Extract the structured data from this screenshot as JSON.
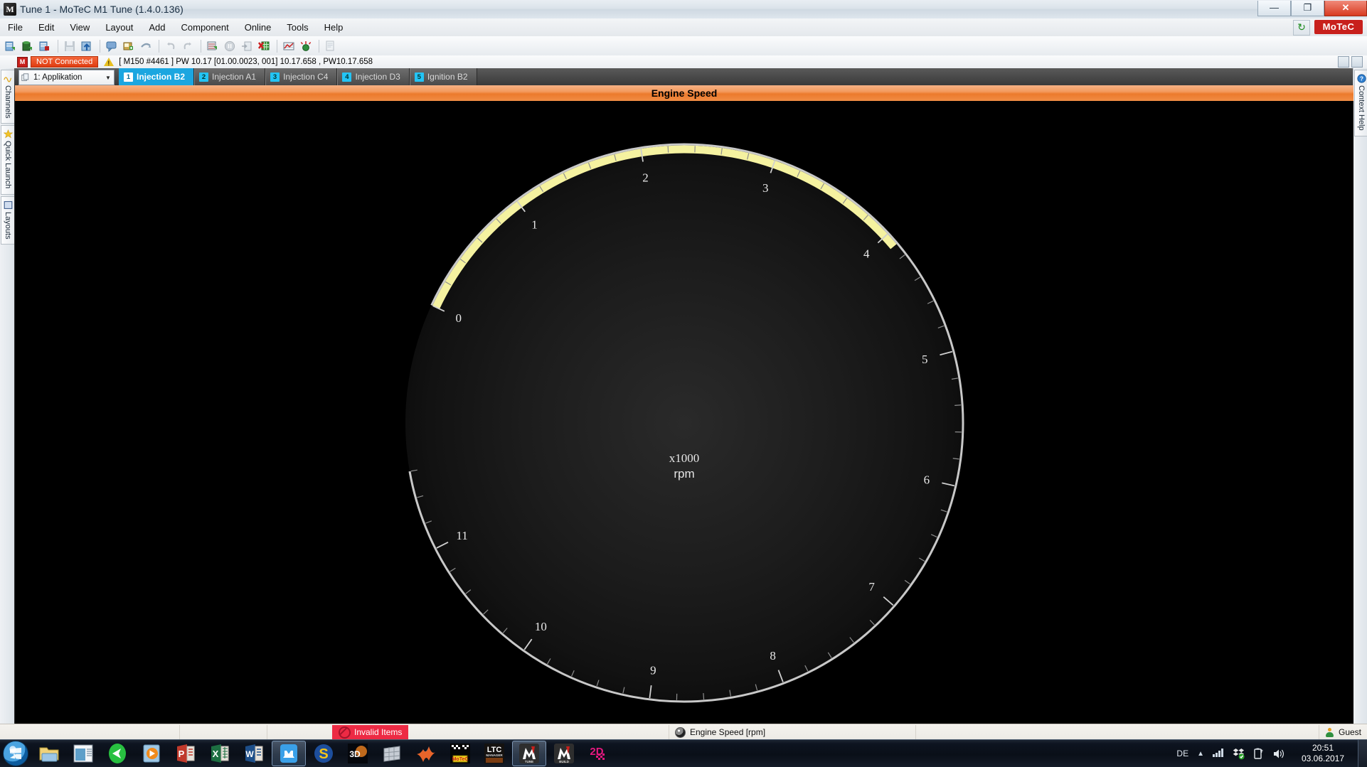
{
  "window": {
    "title": "Tune 1 - MoTeC M1 Tune (1.4.0.136)",
    "icon": "motec-m1-icon",
    "minimize": "—",
    "maximize": "❐",
    "close": "✕"
  },
  "menu": {
    "items": [
      {
        "label": "File"
      },
      {
        "label": "Edit"
      },
      {
        "label": "View"
      },
      {
        "label": "Layout"
      },
      {
        "label": "Add"
      },
      {
        "label": "Component"
      },
      {
        "label": "Online"
      },
      {
        "label": "Tools"
      },
      {
        "label": "Help"
      }
    ],
    "brand": "MoTeC",
    "refresh_icon": "↻"
  },
  "toolbar": {
    "buttons": [
      {
        "name": "new-tune",
        "color": "#6aa3d8"
      },
      {
        "name": "open-package",
        "color": "#2f6f2f"
      },
      {
        "name": "save-tune",
        "color": "#b33a3a"
      },
      {
        "name": "save",
        "color": "#7f8fa0"
      },
      {
        "name": "upload",
        "color": "#3f7fbf"
      },
      {
        "name": "comment",
        "color": "#5d8fc4"
      },
      {
        "name": "add-item",
        "color": "#3f9f3f"
      },
      {
        "name": "refresh-arrow",
        "color": "#8fa6bb"
      },
      {
        "name": "undo",
        "color": "#b8c2cc"
      },
      {
        "name": "redo",
        "color": "#b8c2cc"
      },
      {
        "name": "export-log",
        "color": "#3f9f3f"
      },
      {
        "name": "pause",
        "color": "#9aa6b2"
      },
      {
        "name": "import",
        "color": "#8b98a6"
      },
      {
        "name": "clear-grid",
        "color": "#cc2a2a"
      },
      {
        "name": "chart",
        "color": "#c03030"
      },
      {
        "name": "diagnostics",
        "color": "#2f8f3f"
      },
      {
        "name": "report",
        "color": "#9aa6b2"
      }
    ]
  },
  "connection_strip": {
    "device_badge": "M",
    "status": "NOT Connected",
    "warning_icon": "warning-triangle-icon",
    "info": "[ M150 #4461 ]  PW 10.17 [01.00.0023, 001] 10.17.658 , PW10.17.658"
  },
  "left_sidebar": {
    "tabs": [
      {
        "label": "Channels",
        "icon": "waveform-icon"
      },
      {
        "label": "Quick Launch",
        "icon": "star-icon"
      },
      {
        "label": "Layouts",
        "icon": "window-icon"
      }
    ]
  },
  "right_sidebar": {
    "tabs": [
      {
        "label": "Context Help",
        "icon": "help-question-icon"
      }
    ]
  },
  "workspace": {
    "selector": {
      "value": "1: Applikation",
      "icon": "pages-icon",
      "arrow": "▼"
    },
    "tabs": [
      {
        "num": "1",
        "label": "Injection B2",
        "active": true
      },
      {
        "num": "2",
        "label": "Injection A1",
        "active": false
      },
      {
        "num": "3",
        "label": "Injection C4",
        "active": false
      },
      {
        "num": "4",
        "label": "Injection D3",
        "active": false
      },
      {
        "num": "5",
        "label": "Ignition B2",
        "active": false
      }
    ]
  },
  "gauge": {
    "title": "Engine Speed",
    "center_line1": "x1000",
    "center_line2": "rpm",
    "accent": "#ec7a2c",
    "band_color": "#f5f2a0",
    "scale_color": "#c8c8c8",
    "label_color": "#e8e8e8"
  },
  "chart_data": {
    "type": "gauge",
    "title": "Engine Speed",
    "unit": "rpm",
    "unit_multiplier": "x1000",
    "min": 0,
    "max": 11.6,
    "major_ticks": [
      0,
      1,
      2,
      3,
      4,
      5,
      6,
      7,
      8,
      9,
      10,
      11
    ],
    "tick_labels": [
      "0",
      "1",
      "2",
      "3",
      "4",
      "5",
      "6",
      "6",
      "7",
      "8",
      "9",
      "10",
      "11"
    ],
    "minor_ticks_per_major": 5,
    "start_angle_deg": 205,
    "sweep_deg": 325,
    "value_band": {
      "from": 0,
      "to": 4.1,
      "color": "#f5f2a0"
    },
    "needle_value": null,
    "grid": false,
    "legend": "none"
  },
  "status_bar": {
    "invalid_items": "Invalid Items",
    "invalid_icon": "no-entry-icon",
    "channel": "Engine Speed [rpm]",
    "channel_icon": "gauge-icon",
    "user": "Guest",
    "user_icon": "user-icon"
  },
  "taskbar": {
    "start_icon": "windows-start-icon",
    "items": [
      {
        "name": "file-explorer",
        "label": "",
        "icon": "folder-icon"
      },
      {
        "name": "window-app",
        "label": "",
        "icon": "window-icon"
      },
      {
        "name": "media-player-green",
        "label": "",
        "icon": "play-triangle-icon"
      },
      {
        "name": "media-player-orange",
        "label": "",
        "icon": "media-book-icon"
      },
      {
        "name": "powerpoint",
        "label": "P",
        "icon": "powerpoint-icon"
      },
      {
        "name": "excel",
        "label": "X",
        "icon": "excel-icon"
      },
      {
        "name": "word",
        "label": "W",
        "icon": "word-icon"
      },
      {
        "name": "maxthon",
        "label": "m",
        "icon": "maxthon-icon",
        "active": true
      },
      {
        "name": "sogou",
        "label": "S",
        "icon": "sogou-icon"
      },
      {
        "name": "catia-3ds",
        "label": "3D",
        "icon": "dassault-icon"
      },
      {
        "name": "grid-app",
        "label": "",
        "icon": "mesh-grid-icon"
      },
      {
        "name": "matlab",
        "label": "",
        "icon": "matlab-icon"
      },
      {
        "name": "motec-i2",
        "label": "",
        "icon": "checkered-flag-icon"
      },
      {
        "name": "ltc-manager",
        "label": "LTC",
        "icon": "ltc-manager-icon"
      },
      {
        "name": "m1-tune",
        "label": "M1",
        "icon": "m1-tune-icon",
        "active": true
      },
      {
        "name": "m1-build",
        "label": "M1",
        "icon": "m1-build-icon"
      },
      {
        "name": "2d-software",
        "label": "2D",
        "icon": "twod-icon"
      }
    ],
    "tray": {
      "language": "DE",
      "chevron": "▲",
      "icons": [
        "signal-bars-icon",
        "dropbox-icon",
        "battery-icon",
        "volume-icon"
      ],
      "time": "20:51",
      "date": "03.06.2017"
    }
  }
}
